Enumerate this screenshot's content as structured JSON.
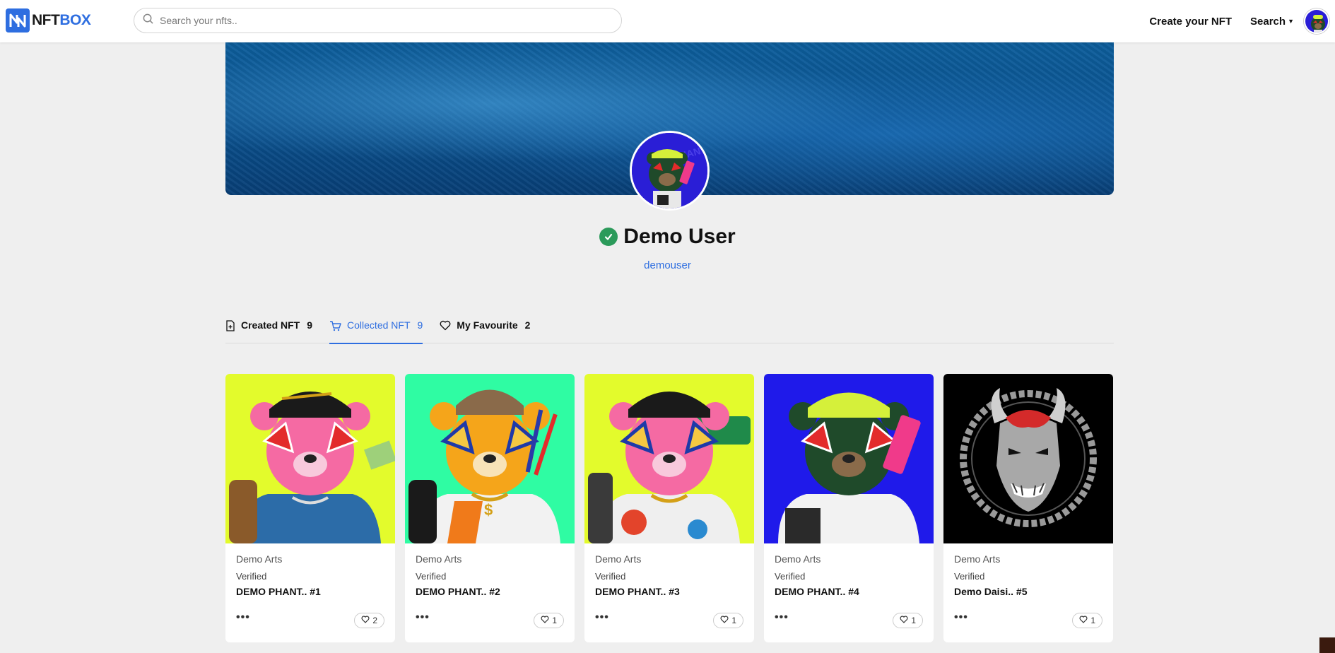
{
  "header": {
    "logo_part1": "NFT",
    "logo_part2": "BOX",
    "search_placeholder": "Search your nfts..",
    "create_link": "Create your NFT",
    "search_menu": "Search"
  },
  "profile": {
    "name": "Demo User",
    "handle": "demouser"
  },
  "tabs": [
    {
      "label": "Created NFT",
      "count": "9",
      "icon": "file-plus-icon",
      "active": false
    },
    {
      "label": "Collected NFT",
      "count": "9",
      "icon": "cart-icon",
      "active": true
    },
    {
      "label": "My Favourite",
      "count": "2",
      "icon": "heart-icon",
      "active": false
    }
  ],
  "cards": [
    {
      "creator": "Demo Arts",
      "verified": "Verified",
      "title": "DEMO PHANT.. #1",
      "likes": "2",
      "bg": "#e3fb2c"
    },
    {
      "creator": "Demo Arts",
      "verified": "Verified",
      "title": "DEMO PHANT.. #2",
      "likes": "1",
      "bg": "#2ffca3"
    },
    {
      "creator": "Demo Arts",
      "verified": "Verified",
      "title": "DEMO PHANT.. #3",
      "likes": "1",
      "bg": "#e3fb2c"
    },
    {
      "creator": "Demo Arts",
      "verified": "Verified",
      "title": "DEMO PHANT.. #4",
      "likes": "1",
      "bg": "#1f1aea"
    },
    {
      "creator": "Demo Arts",
      "verified": "Verified",
      "title": "Demo Daisi.. #5",
      "likes": "1",
      "bg": "#000000"
    }
  ],
  "colors": {
    "accent": "#2e6ee0",
    "verified_check": "#2b9a5a"
  }
}
